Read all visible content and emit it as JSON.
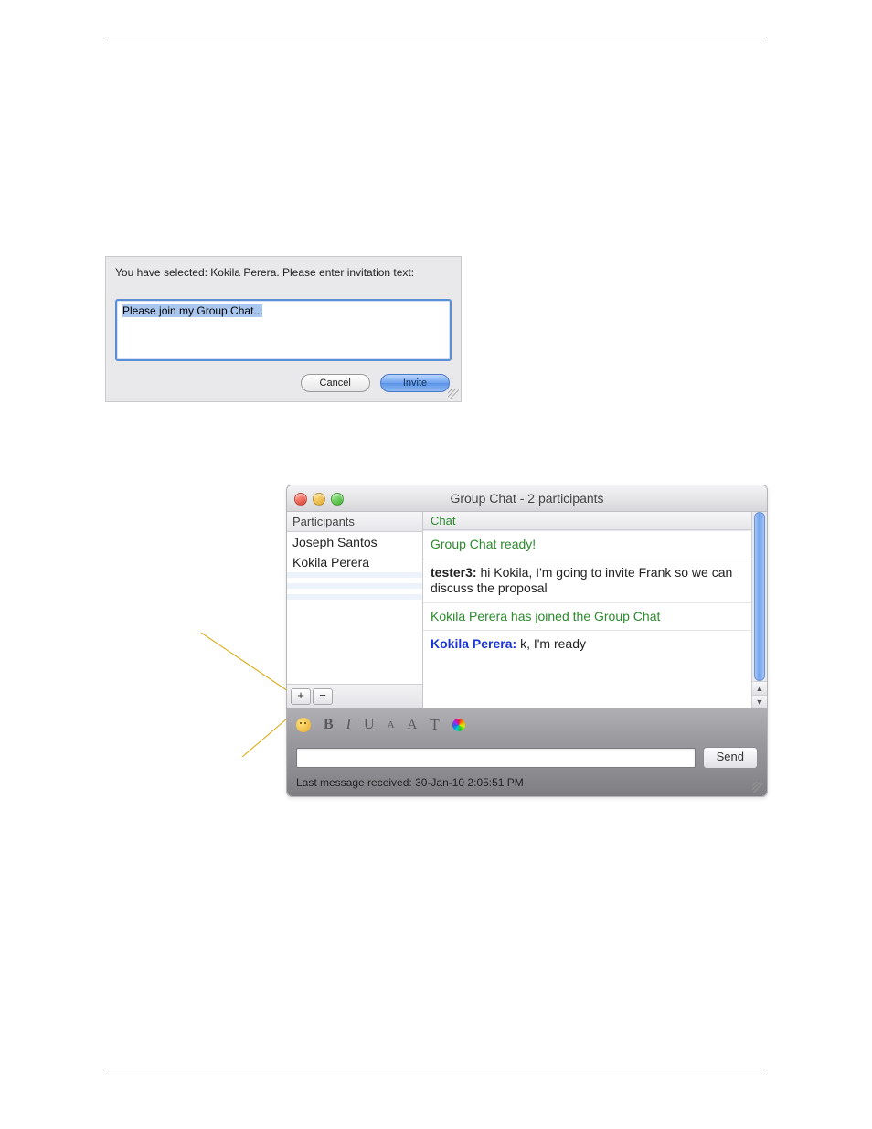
{
  "invite_dialog": {
    "prompt": "You have selected: Kokila Perera. Please enter invitation text:",
    "text_value": "Please join my Group Chat...",
    "cancel_label": "Cancel",
    "invite_label": "Invite"
  },
  "chat_window": {
    "title": "Group Chat - 2 participants",
    "participants_header": "Participants",
    "participants": [
      "Joseph Santos",
      "Kokila Perera"
    ],
    "messages_header": "Chat",
    "messages": [
      {
        "type": "system",
        "text": "Group Chat ready!"
      },
      {
        "type": "user",
        "who": "tester3",
        "text": "hi Kokila, I'm going to invite Frank so we can discuss the proposal",
        "who_color": "black"
      },
      {
        "type": "system",
        "text": "Kokila Perera has joined the Group Chat"
      },
      {
        "type": "user",
        "who": "Kokila Perera",
        "text": "k, I'm ready",
        "who_color": "blue"
      }
    ],
    "add_label": "+",
    "remove_label": "−",
    "send_label": "Send",
    "status": "Last message received: 30-Jan-10 2:05:51 PM",
    "toolbar": {
      "bold": "B",
      "italic": "I",
      "underline": "U",
      "a_small": "A",
      "a_large": "A",
      "font": "T"
    }
  }
}
